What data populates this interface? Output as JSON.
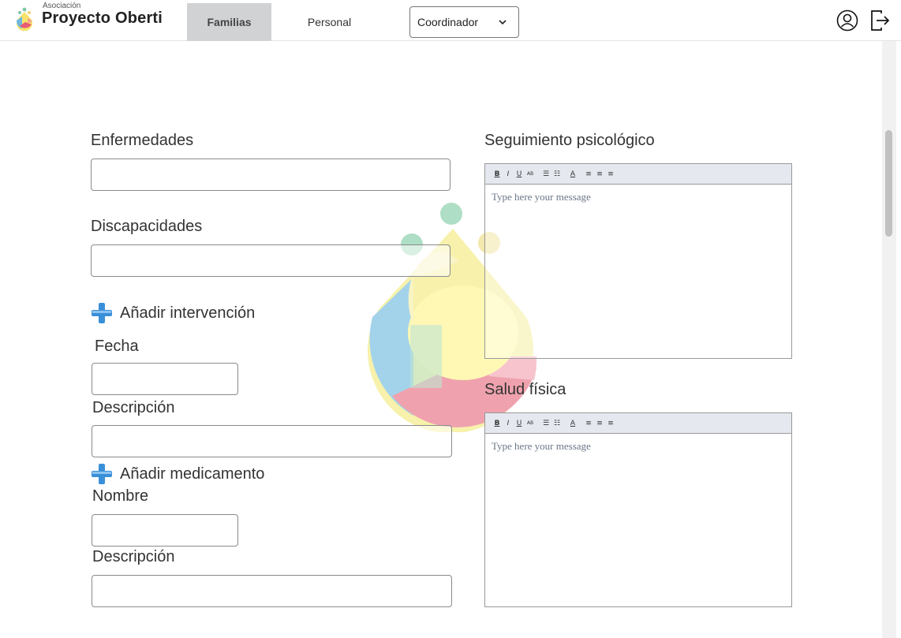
{
  "header": {
    "logo_small": "Asociación",
    "logo_big": "Proyecto Oberti",
    "tabs": [
      {
        "label": "Familias",
        "active": true
      },
      {
        "label": "Personal",
        "active": false
      }
    ],
    "role_select": {
      "value": "Coordinador",
      "icon": "chevron-down-icon"
    },
    "icons": [
      "user-icon",
      "logout-icon"
    ]
  },
  "form": {
    "enfermedades_label": "Enfermedades",
    "discapacidades_label": "Discapacidades",
    "add_intervention_label": "Añadir intervención",
    "fecha_label": "Fecha",
    "descripcion_label_1": "Descripción",
    "add_medication_label": "Añadir medicamento",
    "nombre_label": "Nombre",
    "descripcion_label_2": "Descripción"
  },
  "editors": {
    "seguimiento_label": "Seguimiento psicológico",
    "salud_label": "Salud física",
    "placeholder": "Type here your message",
    "toolbar": [
      "B",
      "I",
      "U",
      "AB",
      "☰",
      "☷",
      "A",
      "≡",
      "≡",
      "≡"
    ]
  },
  "colors": {
    "accent_plus": "#3a8fd9",
    "active_tab": "#d0d2d4"
  }
}
